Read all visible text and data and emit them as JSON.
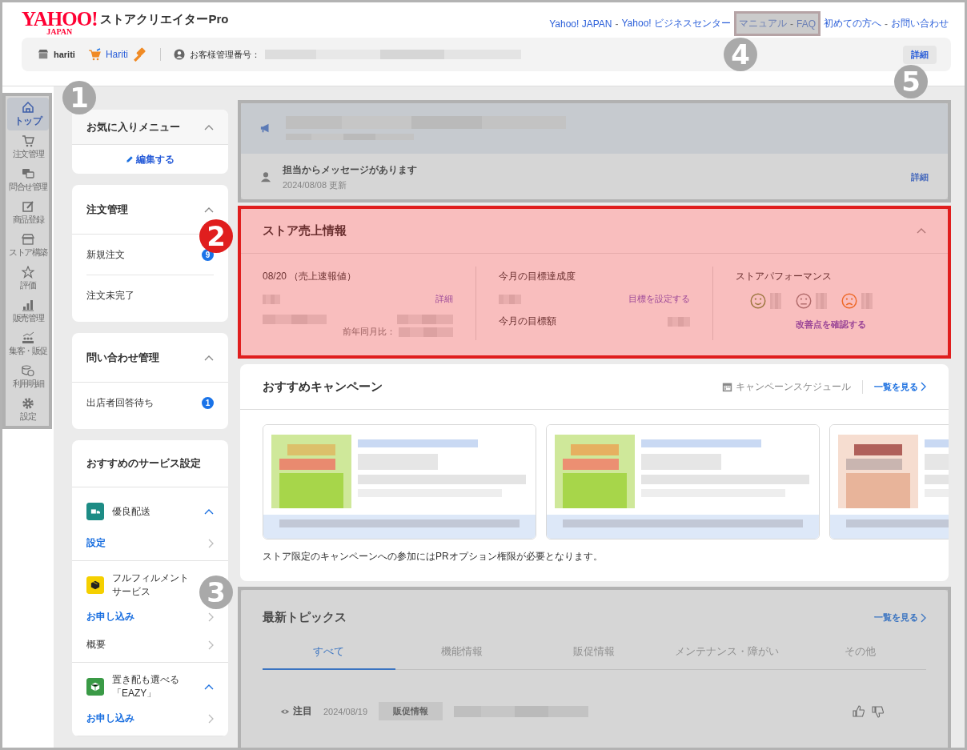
{
  "header": {
    "logo": "YAHOO!",
    "logo_sub": "JAPAN",
    "product": "ストアクリエイターPro",
    "separator": "-",
    "link_groups": [
      {
        "links": [
          "Yahoo! JAPAN",
          "Yahoo! ビジネスセンター"
        ],
        "highlighted": false
      },
      {
        "links": [
          "マニュアル",
          "FAQ"
        ],
        "highlighted": true
      },
      {
        "links": [
          "初めての方へ",
          "お問い合わせ"
        ],
        "highlighted": false
      }
    ]
  },
  "store_bar": {
    "store_name": "hariti",
    "shop_link": "Hariti",
    "customer_label": "お客様管理番号：",
    "detail_button": "詳細"
  },
  "nav": {
    "highlight": {
      "color": "#b0b0b0"
    },
    "items": [
      {
        "label": "トップ",
        "selected": true
      },
      {
        "label": "注文管理",
        "selected": false
      },
      {
        "label": "問合せ管理",
        "selected": false
      },
      {
        "label": "商品登録",
        "selected": false
      },
      {
        "label": "ストア構築",
        "selected": false
      },
      {
        "label": "評価",
        "selected": false
      },
      {
        "label": "販売管理",
        "selected": false
      },
      {
        "label": "集客・販促",
        "selected": false
      },
      {
        "label": "利用明細",
        "selected": false
      },
      {
        "label": "設定",
        "selected": false
      }
    ]
  },
  "sidebar": {
    "favorites": {
      "title": "お気に入りメニュー",
      "expanded": true,
      "edit_link": "編集する"
    },
    "panels": [
      {
        "title": "注文管理",
        "expanded": true,
        "items": [
          {
            "label": "新規注文",
            "badge": "9"
          },
          {
            "label": "注文未完了"
          }
        ]
      },
      {
        "title": "問い合わせ管理",
        "expanded": true,
        "items": [
          {
            "label": "出店者回答待ち",
            "badge": "1"
          }
        ]
      }
    ],
    "services": {
      "title": "おすすめのサービス設定",
      "items": [
        {
          "name": "優良配送",
          "color": "#1d8c85",
          "expanded": true,
          "links": [
            {
              "label": "設定",
              "kind": "link"
            }
          ]
        },
        {
          "name": "フルフィルメントサービス",
          "color": "#f5d000",
          "links": [
            {
              "label": "お申し込み",
              "kind": "link"
            },
            {
              "label": "概要",
              "kind": "plain"
            }
          ]
        },
        {
          "name": "置き配も選べる「EAZY」",
          "color": "#3a9a46",
          "expanded": true,
          "links": [
            {
              "label": "お申し込み",
              "kind": "link"
            }
          ]
        }
      ]
    }
  },
  "notice": {
    "highlight": {
      "color": "#b1b1b1"
    },
    "message": "担当からメッセージがあります",
    "updated": "2024/08/08 更新",
    "detail_link": "詳細"
  },
  "sales": {
    "highlight": {
      "color": "#e01e1e"
    },
    "title": "ストア売上情報",
    "expanded": true,
    "date_label": "08/20 （売上速報値）",
    "detail_link": "詳細",
    "yoy_label": "前年同月比：",
    "goal_label": "今月の目標達成度",
    "set_goal_link": "目標を設定する",
    "goal_amount_label": "今月の目標額",
    "performance_label": "ストアパフォーマンス",
    "moods": [
      {
        "kind": "good"
      },
      {
        "kind": "neutral"
      },
      {
        "kind": "bad"
      }
    ],
    "improve_link": "改善点を確認する"
  },
  "campaigns": {
    "title": "おすすめキャンペーン",
    "schedule_link": "キャンペーンスケジュール",
    "all_link": "一覧を見る",
    "note": "ストア限定のキャンペーンへの参加にはPRオプション権限が必要となります。"
  },
  "topics": {
    "highlight": {
      "color": "#b2b2b2"
    },
    "title": "最新トピックス",
    "all_link": "一覧を見る",
    "tabs": [
      {
        "label": "すべて",
        "selected": true
      },
      {
        "label": "機能情報",
        "selected": false
      },
      {
        "label": "販促情報",
        "selected": false
      },
      {
        "label": "メンテナンス・障がい",
        "selected": false
      },
      {
        "label": "その他",
        "selected": false
      }
    ],
    "rows": [
      {
        "flag": "注目",
        "date": "2024/08/19",
        "tag": "販促情報"
      }
    ]
  },
  "annotations": [
    {
      "label": "1",
      "color": "#a8a8a8"
    },
    {
      "label": "2",
      "color": "#e01e1e"
    },
    {
      "label": "3",
      "color": "#a9a9a9"
    },
    {
      "label": "4",
      "color": "#aaaaaa"
    },
    {
      "label": "5",
      "color": "#a7a7a7"
    }
  ]
}
